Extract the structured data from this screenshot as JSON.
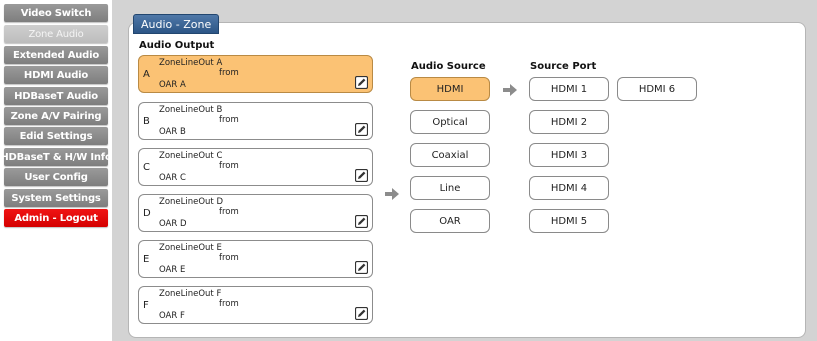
{
  "sidebar": {
    "items": [
      {
        "label": "Video Switch"
      },
      {
        "label": "Zone Audio"
      },
      {
        "label": "Extended Audio"
      },
      {
        "label": "HDMI Audio"
      },
      {
        "label": "HDBaseT Audio"
      },
      {
        "label": "Zone A/V Pairing"
      },
      {
        "label": "Edid Settings"
      },
      {
        "label": "HDBaseT & H/W Info"
      },
      {
        "label": "User Config"
      },
      {
        "label": "System Settings"
      },
      {
        "label": "Admin - Logout"
      }
    ],
    "active_index": 1
  },
  "panel": {
    "title": "Audio - Zone"
  },
  "audio_output": {
    "heading": "Audio Output",
    "zones": [
      {
        "letter": "A",
        "name": "ZoneLineOut A",
        "from": "from",
        "source": "OAR A",
        "selected": true
      },
      {
        "letter": "B",
        "name": "ZoneLineOut B",
        "from": "from",
        "source": "OAR B",
        "selected": false
      },
      {
        "letter": "C",
        "name": "ZoneLineOut C",
        "from": "from",
        "source": "OAR C",
        "selected": false
      },
      {
        "letter": "D",
        "name": "ZoneLineOut D",
        "from": "from",
        "source": "OAR D",
        "selected": false
      },
      {
        "letter": "E",
        "name": "ZoneLineOut E",
        "from": "from",
        "source": "OAR E",
        "selected": false
      },
      {
        "letter": "F",
        "name": "ZoneLineOut F",
        "from": "from",
        "source": "OAR F",
        "selected": false
      }
    ]
  },
  "audio_source": {
    "heading": "Audio Source",
    "options": [
      "HDMI",
      "Optical",
      "Coaxial",
      "Line",
      "OAR"
    ],
    "selected": "HDMI"
  },
  "source_port": {
    "heading": "Source Port",
    "ports": [
      "HDMI 1",
      "HDMI 2",
      "HDMI 3",
      "HDMI 4",
      "HDMI 5",
      "HDMI 6"
    ]
  },
  "colors": {
    "selected": "#fbc274",
    "tab": "#3a6496",
    "logout": "#e00000",
    "nav": "#8a8a8a"
  }
}
